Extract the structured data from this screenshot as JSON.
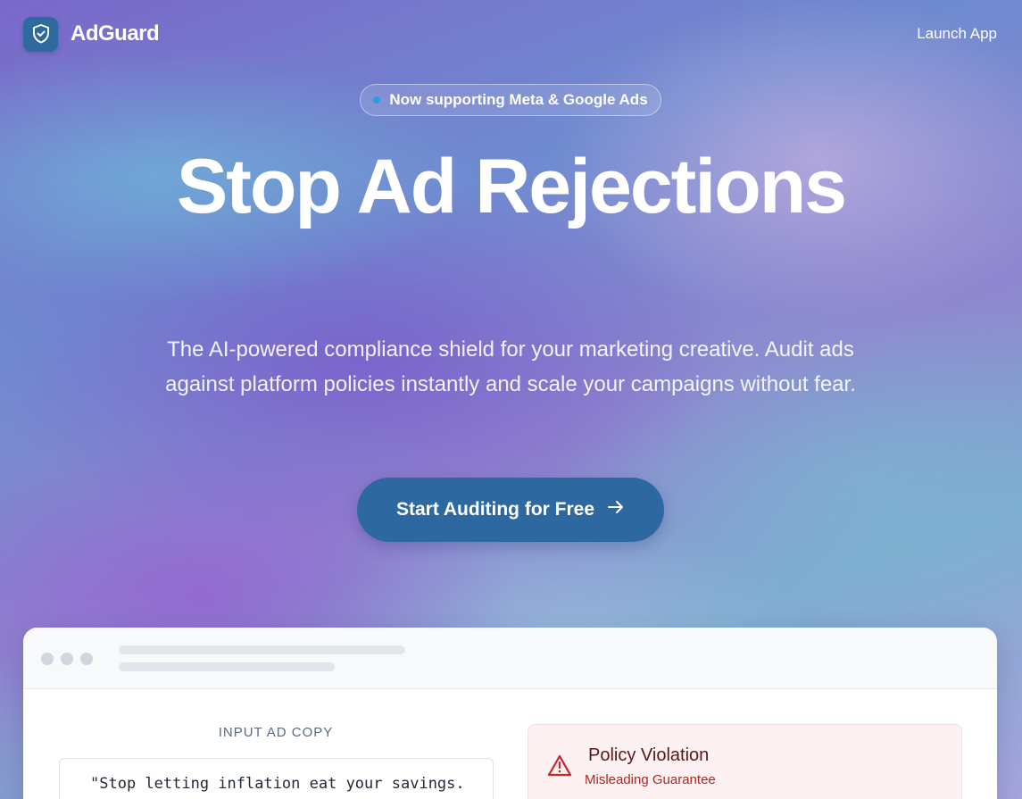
{
  "header": {
    "brand_name": "AdGuard",
    "launch_label": "Launch App"
  },
  "hero": {
    "badge": "Now supporting Meta & Google Ads",
    "title": "Stop Ad Rejections",
    "subtitle": "The AI-powered compliance shield for your marketing creative. Audit ads against platform policies instantly and scale your campaigns without fear.",
    "cta_label": "Start Auditing for Free"
  },
  "preview": {
    "input_label": "INPUT AD COPY",
    "input_text": "\"Stop letting inflation eat your savings.",
    "violation_title": "Policy Violation",
    "violation_reason": "Misleading Guarantee"
  },
  "colors": {
    "accent": "#2e68a0",
    "logo_bg": "#2d6a9f",
    "badge_dot": "#2e9be0",
    "danger": "#b3261e",
    "danger_bg": "#fdf1f1"
  },
  "icons": {
    "logo": "shield-check-icon",
    "cta": "arrow-right-icon",
    "violation": "warning-triangle-icon"
  }
}
